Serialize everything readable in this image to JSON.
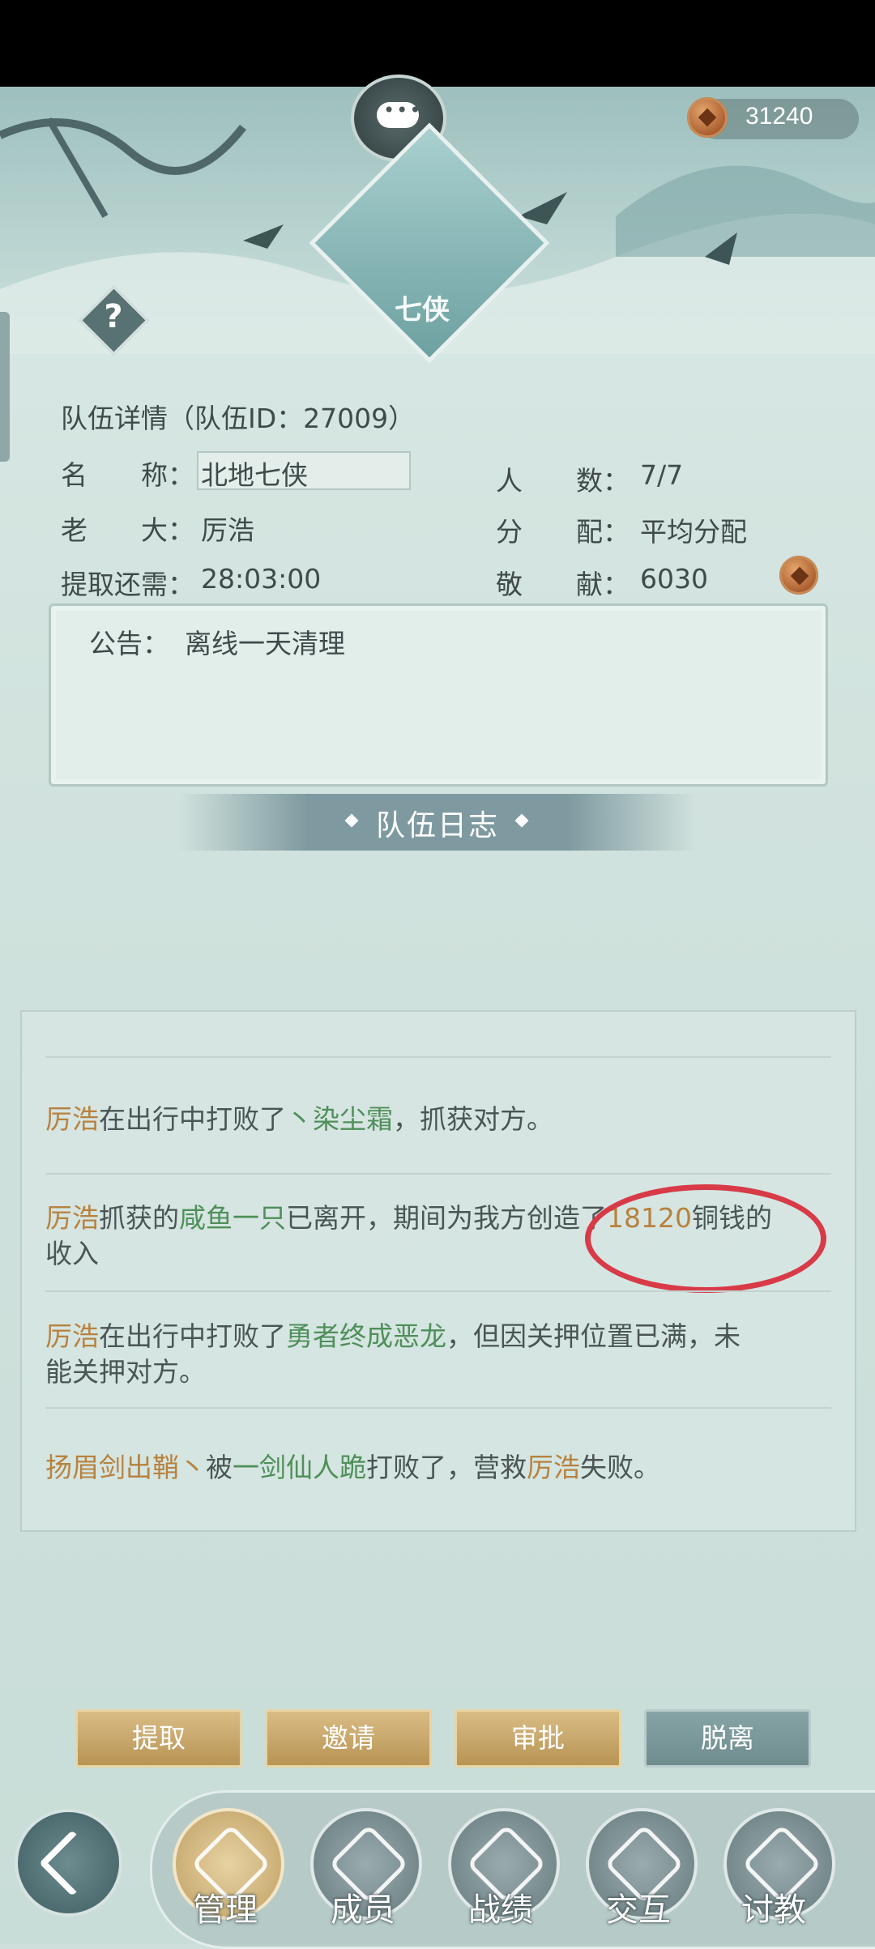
{
  "header": {
    "coins": "31240",
    "emblem_text": "七侠",
    "help_label": "?"
  },
  "team": {
    "title": "队伍详情（队伍ID：27009）",
    "name_label": "名　　称：",
    "name_value": "北地七侠",
    "members_label": "人　　数：",
    "members_value": "7/7",
    "leader_label": "老　　大：",
    "leader_value": "厉浩",
    "distribution_label": "分　　配：",
    "distribution_value": "平均分配",
    "withdraw_label": "提取还需：",
    "withdraw_value": "28:03:00",
    "contribution_label": "敬　　献：",
    "contribution_value": "6030"
  },
  "notice": {
    "label": "公告：",
    "text": "离线一天清理"
  },
  "log": {
    "title": "队伍日志",
    "entries": [
      {
        "a": "厉浩",
        "b": "在出行中打败了",
        "c": "丶染尘霜",
        "d": "，抓获对方。"
      },
      {
        "a": "厉浩",
        "b": "抓获的",
        "c": "咸鱼一只",
        "d": "已离开，期间为我方创造了",
        "e": "18120",
        "f": "铜钱的",
        "g": "收入"
      },
      {
        "a": "厉浩",
        "b": "在出行中打败了",
        "c": "勇者终成恶龙",
        "d": "，但因关押位置已满，未",
        "e": "能关押对方。"
      },
      {
        "a": "扬眉剑出鞘丶",
        "b": "被",
        "c": "一剑仙人跪",
        "d": "打败了，营救",
        "e": "厉浩",
        "f": "失败。"
      }
    ]
  },
  "actions": {
    "withdraw": "提取",
    "invite": "邀请",
    "approve": "审批",
    "leave": "脱离"
  },
  "nav": {
    "tabs": [
      "管理",
      "成员",
      "战绩",
      "交互",
      "讨教"
    ]
  }
}
